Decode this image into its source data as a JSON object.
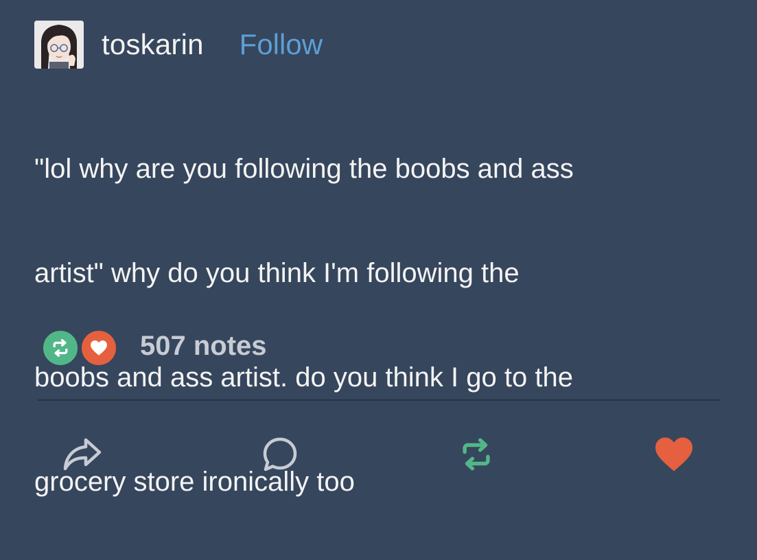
{
  "post": {
    "username": "toskarin",
    "follow_label": "Follow",
    "body_lines": [
      "\"lol why are you following the boobs and ass",
      "artist\" why do you think I'm following the",
      "boobs and ass artist. do you think I go to the",
      "grocery store ironically too"
    ],
    "notes_label": "507 notes"
  },
  "colors": {
    "background": "#36465d",
    "follow_link": "#5d9fd4",
    "reblog_green": "#52b788",
    "like_red": "#e5603e",
    "divider": "#26334a"
  },
  "icons": {
    "note_badges": [
      "reblog-icon",
      "heart-icon"
    ],
    "actions": [
      "share-icon",
      "reply-icon",
      "reblog-icon",
      "heart-icon"
    ]
  },
  "state": {
    "reblogged": true,
    "liked": true
  }
}
